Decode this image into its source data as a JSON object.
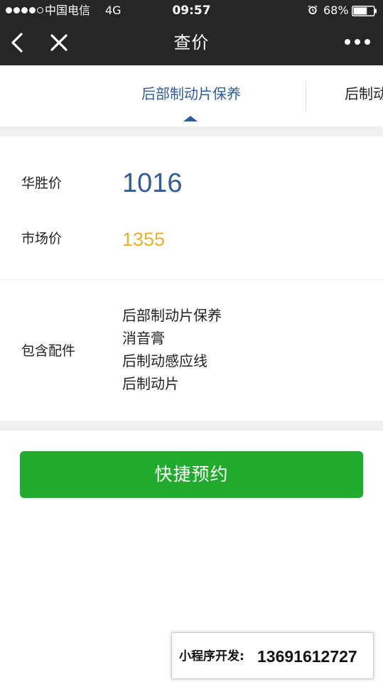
{
  "status_bar": {
    "carrier": "中国电信",
    "network": "4G",
    "time": "09:57",
    "battery": "68%",
    "battery_level": 0.68
  },
  "nav": {
    "title": "查价"
  },
  "tabs": [
    {
      "label": "后部制动片保养",
      "active": true
    },
    {
      "label": "后制动",
      "active": false
    }
  ],
  "prices": {
    "huasheng_label": "华胜价",
    "huasheng_value": "1016",
    "market_label": "市场价",
    "market_value": "1355"
  },
  "parts": {
    "label": "包含配件",
    "items": [
      "后部制动片保养",
      "消音膏",
      "后制动感应线",
      "后制动片"
    ]
  },
  "actions": {
    "book_label": "快捷预约"
  },
  "promo": {
    "label": "小程序开发:",
    "phone": "13691612727"
  },
  "colors": {
    "topbar": "#262626",
    "accent_blue": "#2f5d9c",
    "market_price": "#e4b22c",
    "button_green": "#21ab2c"
  }
}
